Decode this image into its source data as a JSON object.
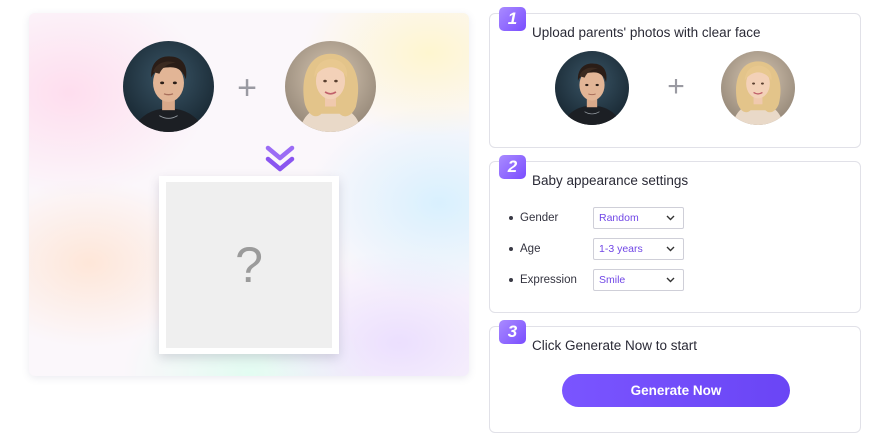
{
  "preview": {
    "plus_symbol": "+",
    "placeholder_symbol": "?",
    "parent_left_avatar": "male-parent-photo",
    "parent_right_avatar": "female-parent-photo",
    "arrow_icon": "double-chevron-down-icon"
  },
  "steps": [
    {
      "number": "1",
      "title": "Upload parents' photos with clear face",
      "plus_symbol": "+"
    },
    {
      "number": "2",
      "title": "Baby appearance settings",
      "settings": [
        {
          "label": "Gender",
          "value": "Random"
        },
        {
          "label": "Age",
          "value": "1-3 years"
        },
        {
          "label": "Expression",
          "value": "Smile"
        }
      ]
    },
    {
      "number": "3",
      "title": "Click Generate Now to start",
      "button_label": "Generate Now"
    }
  ],
  "colors": {
    "accent": "#7046e6",
    "button": "#6e4bff",
    "badge": "#8a63ff"
  }
}
